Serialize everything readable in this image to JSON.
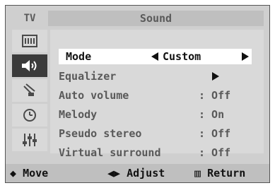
{
  "header": {
    "tv_label": "TV",
    "title": "Sound"
  },
  "sidebar": {
    "icons": [
      {
        "name": "picture-icon"
      },
      {
        "name": "speaker-icon",
        "active": true
      },
      {
        "name": "antenna-icon"
      },
      {
        "name": "clock-icon"
      },
      {
        "name": "equalizer-icon"
      }
    ]
  },
  "menu": {
    "items": [
      {
        "label": "Mode",
        "value": "Custom",
        "selected": true
      },
      {
        "label": "Equalizer",
        "value": ""
      },
      {
        "label": "Auto volume",
        "value": ": Off"
      },
      {
        "label": "Melody",
        "value": ": On"
      },
      {
        "label": "Pseudo stereo",
        "value": ": Off"
      },
      {
        "label": "Virtual surround",
        "value": ": Off"
      }
    ]
  },
  "footer": {
    "move_label": "Move",
    "adjust_label": "Adjust",
    "return_label": "Return"
  },
  "colors": {
    "osd_bg": "#cfcfcf",
    "title_bg": "#bfbfbf",
    "selected_bg": "#ffffff",
    "active_icon_bg": "#3b3b3b"
  }
}
